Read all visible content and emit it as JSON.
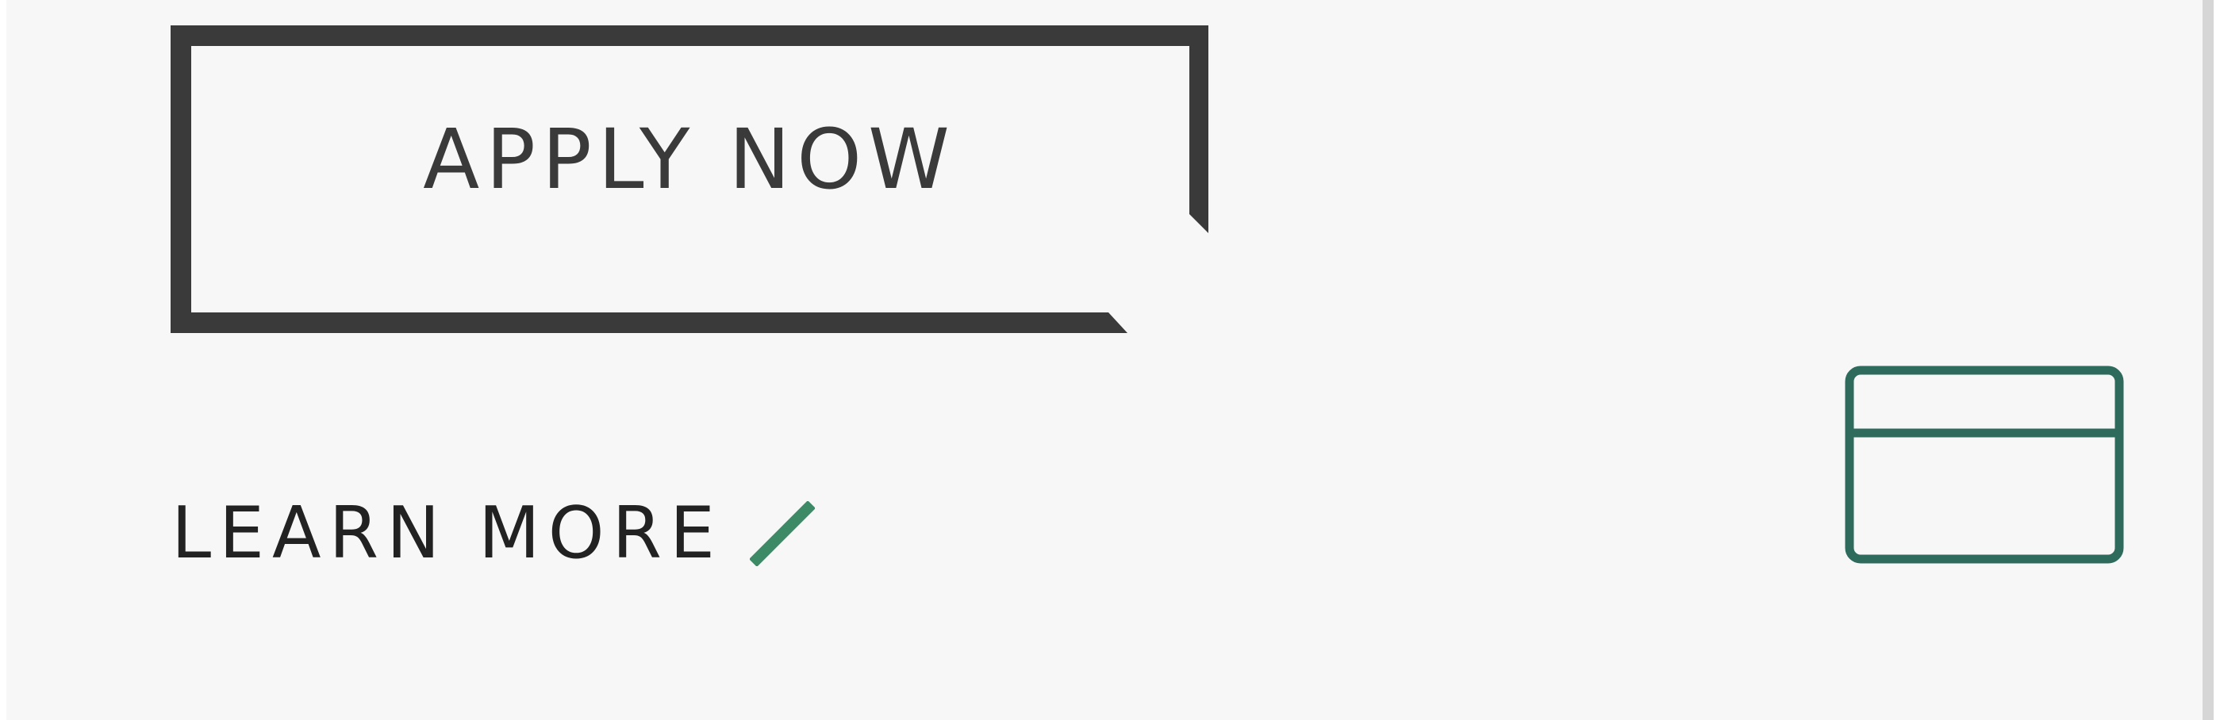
{
  "cta": {
    "apply_label": "APPLY NOW"
  },
  "links": {
    "learn_more_label": "LEARN MORE",
    "arrow_icon": "diagonal-arrow-icon"
  },
  "icons": {
    "card": "credit-card-icon"
  },
  "colors": {
    "background": "#f7f7f7",
    "button_border": "#3a3a3a",
    "text_dark": "#222222",
    "accent_green": "#3d8a66",
    "icon_teal": "#2f6b5c"
  }
}
